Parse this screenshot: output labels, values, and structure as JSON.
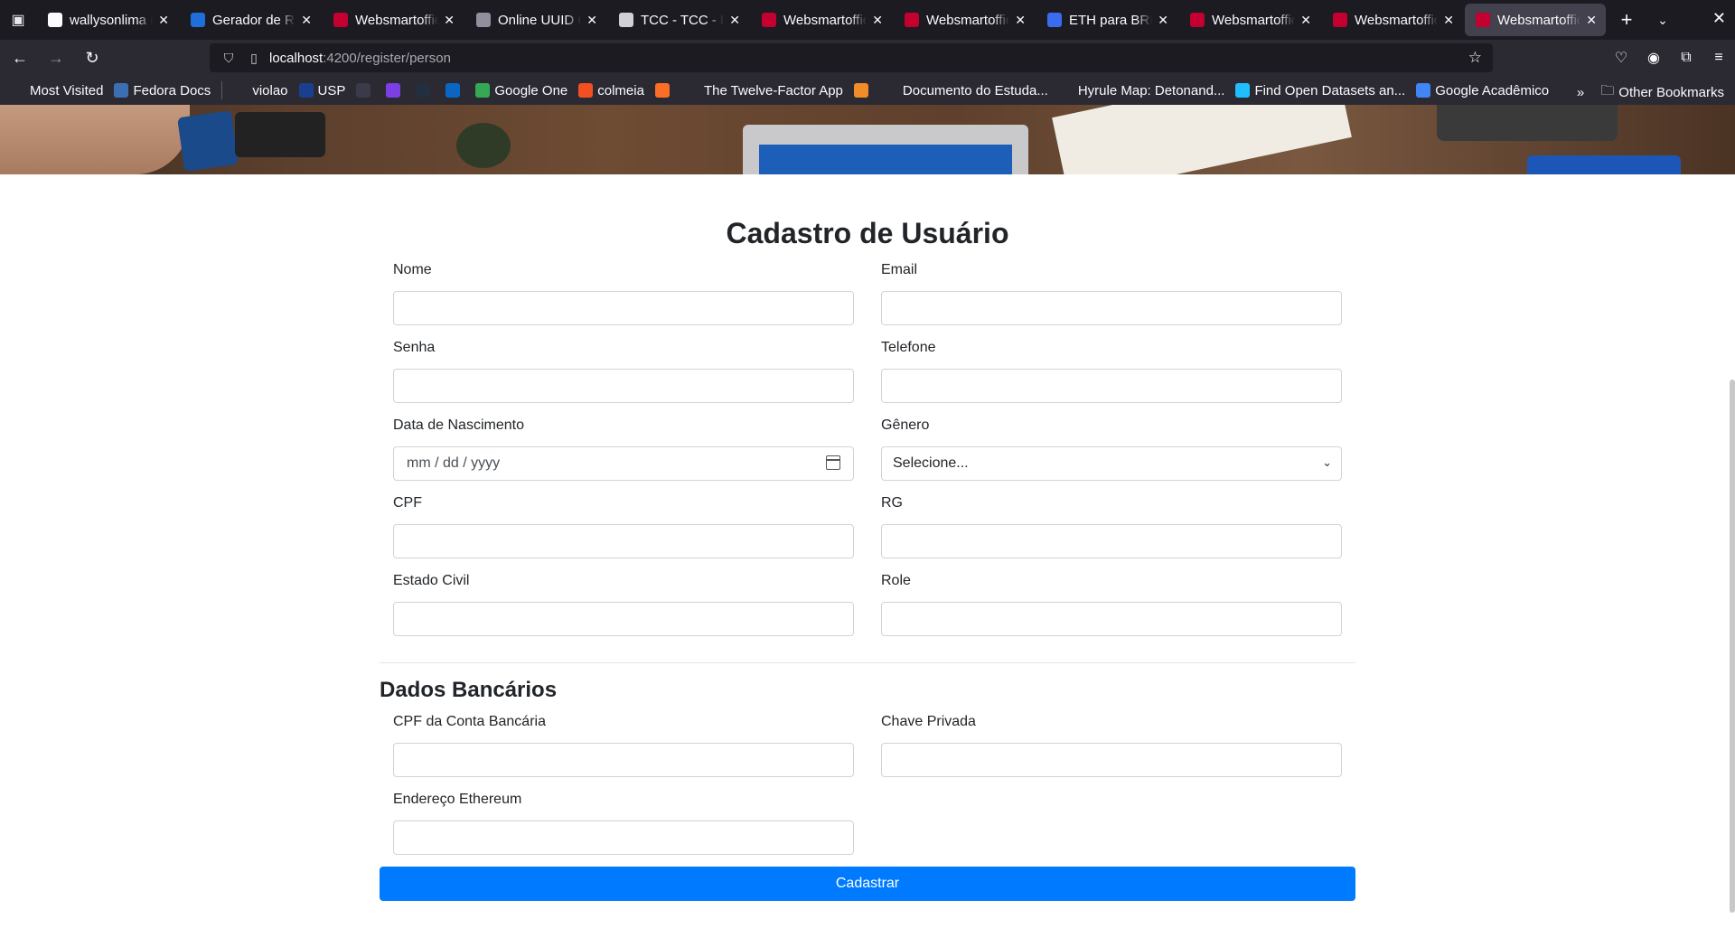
{
  "browser": {
    "tabs": [
      {
        "title": "wallysonlima (W",
        "favicon": "github-icon",
        "color": "#fbfbfe",
        "active": false
      },
      {
        "title": "Gerador de RG",
        "favicon": "generator-icon",
        "color": "#1e6fd9",
        "active": false
      },
      {
        "title": "Websmartoffic",
        "favicon": "angular-icon",
        "color": "#c3002f",
        "active": false
      },
      {
        "title": "Online UUID Ge",
        "favicon": "globe-icon",
        "color": "#8f8f9d",
        "active": false
      },
      {
        "title": "TCC - TCC - Fro",
        "favicon": "tcc-icon",
        "color": "#d0d0d8",
        "active": false
      },
      {
        "title": "Websmartoffic",
        "favicon": "angular-icon",
        "color": "#c3002f",
        "active": false
      },
      {
        "title": "Websmartoffic",
        "favicon": "angular-icon",
        "color": "#c3002f",
        "active": false
      },
      {
        "title": "ETH para BRL: (",
        "favicon": "exchange-icon",
        "color": "#3b6cf0",
        "active": false
      },
      {
        "title": "Websmartoffic",
        "favicon": "angular-icon",
        "color": "#c3002f",
        "active": false
      },
      {
        "title": "Websmartoffic",
        "favicon": "angular-icon",
        "color": "#c3002f",
        "active": false
      },
      {
        "title": "Websmartoffic",
        "favicon": "angular-icon",
        "color": "#c3002f",
        "active": true
      }
    ],
    "url_host": "localhost",
    "url_path": ":4200/register/person",
    "bookmarks": [
      {
        "label": "Most Visited",
        "icon": "gear-icon",
        "color": "#2b2a33"
      },
      {
        "label": "Fedora Docs",
        "icon": "fedora-icon",
        "color": "#3c6eb4"
      },
      {
        "label": "violao",
        "icon": "globe-icon",
        "color": "#2b2a33"
      },
      {
        "label": "USP",
        "icon": "usp-icon",
        "color": "#1b3f8f"
      },
      {
        "label": "",
        "icon": "kaggle-icon",
        "color": "#3a3a4a"
      },
      {
        "label": "",
        "icon": "purple-app-icon",
        "color": "#7b3fe4"
      },
      {
        "label": "",
        "icon": "amazon-icon",
        "color": "#232f3e"
      },
      {
        "label": "",
        "icon": "linkedin-icon",
        "color": "#0a66c2"
      },
      {
        "label": "Google One",
        "icon": "google-one-icon",
        "color": "#34a853"
      },
      {
        "label": "colmeia",
        "icon": "microsoft-icon",
        "color": "#f25022"
      },
      {
        "label": "",
        "icon": "gitlab-icon",
        "color": "#fc6d26"
      },
      {
        "label": "The Twelve-Factor App",
        "icon": "diamond-icon",
        "color": "#2b2a33"
      },
      {
        "label": "",
        "icon": "box-icon",
        "color": "#f28c28"
      },
      {
        "label": "Documento do Estuda...",
        "icon": "doc-icon",
        "color": "#2b2a33"
      },
      {
        "label": "Hyrule Map: Detonand...",
        "icon": "globe-icon",
        "color": "#2b2a33"
      },
      {
        "label": "Find Open Datasets an...",
        "icon": "kaggle-icon",
        "color": "#20beff"
      },
      {
        "label": "Google Acadêmico",
        "icon": "scholar-icon",
        "color": "#4285f4"
      }
    ],
    "other_bookmarks": "Other Bookmarks"
  },
  "page": {
    "title": "Cadastro de Usuário",
    "fields": {
      "nome": {
        "label": "Nome",
        "value": ""
      },
      "email": {
        "label": "Email",
        "value": ""
      },
      "senha": {
        "label": "Senha",
        "value": ""
      },
      "telefone": {
        "label": "Telefone",
        "value": ""
      },
      "nascimento": {
        "label": "Data de Nascimento",
        "placeholder": "mm / dd / yyyy"
      },
      "genero": {
        "label": "Gênero",
        "selected": "Selecione..."
      },
      "cpf": {
        "label": "CPF",
        "value": ""
      },
      "rg": {
        "label": "RG",
        "value": ""
      },
      "estado_civil": {
        "label": "Estado Civil",
        "value": ""
      },
      "role": {
        "label": "Role",
        "value": ""
      }
    },
    "bank_section": {
      "title": "Dados Bancários",
      "cpf_conta": {
        "label": "CPF da Conta Bancária",
        "value": ""
      },
      "chave_privada": {
        "label": "Chave Privada",
        "value": ""
      },
      "endereco_eth": {
        "label": "Endereço Ethereum",
        "value": ""
      }
    },
    "submit_label": "Cadastrar",
    "accent_color": "#007bff"
  }
}
